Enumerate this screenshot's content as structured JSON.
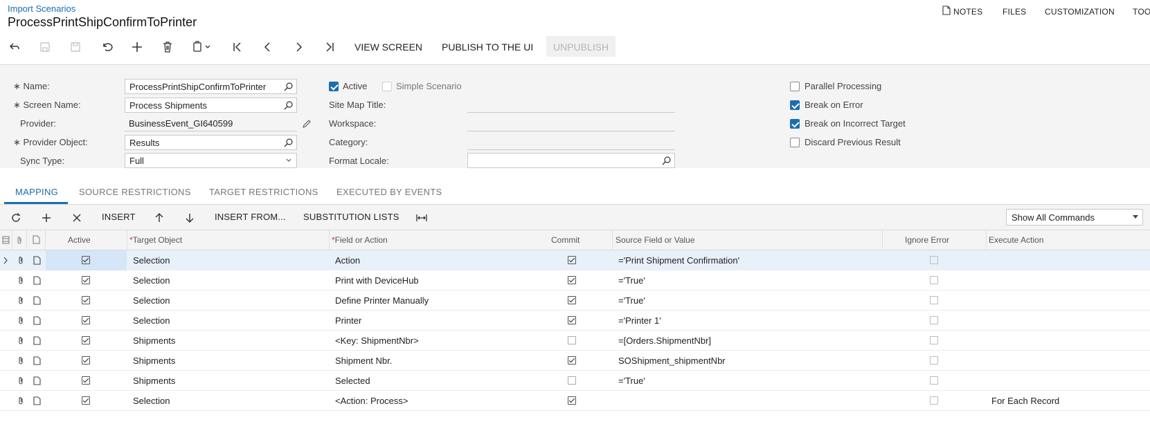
{
  "breadcrumb": "Import Scenarios",
  "page_title": "ProcessPrintShipConfirmToPrinter",
  "top_nav": [
    "NOTES",
    "FILES",
    "CUSTOMIZATION",
    "TOO"
  ],
  "toolbar": {
    "view_screen": "VIEW SCREEN",
    "publish": "PUBLISH TO THE UI",
    "unpublish": "UNPUBLISH"
  },
  "form": {
    "name_label": "Name:",
    "name_value": "ProcessPrintShipConfirmToPrinter",
    "screen_name_label": "Screen Name:",
    "screen_name_value": "Process Shipments",
    "provider_label": "Provider:",
    "provider_value": "BusinessEvent_GI640599",
    "provider_object_label": "Provider Object:",
    "provider_object_value": "Results",
    "sync_type_label": "Sync Type:",
    "sync_type_value": "Full",
    "active_label": "Active",
    "simple_label": "Simple Scenario",
    "site_map_label": "Site Map Title:",
    "workspace_label": "Workspace:",
    "category_label": "Category:",
    "format_locale_label": "Format Locale:",
    "parallel_label": "Parallel Processing",
    "break_error_label": "Break on Error",
    "break_target_label": "Break on Incorrect Target",
    "discard_label": "Discard Previous Result"
  },
  "tabs": [
    "MAPPING",
    "SOURCE RESTRICTIONS",
    "TARGET RESTRICTIONS",
    "EXECUTED BY EVENTS"
  ],
  "grid_toolbar": {
    "insert": "INSERT",
    "insert_from": "INSERT FROM...",
    "substitution": "SUBSTITUTION LISTS",
    "filter_value": "Show All Commands"
  },
  "columns": {
    "active": "Active",
    "target": "Target Object",
    "field": "Field or Action",
    "commit": "Commit",
    "source": "Source Field or Value",
    "ignore": "Ignore Error",
    "execute": "Execute Action"
  },
  "rows": [
    {
      "target": "Selection",
      "field": "Action",
      "commit": true,
      "source": "='Print Shipment Confirmation'",
      "execute": ""
    },
    {
      "target": "Selection",
      "field": "Print with DeviceHub",
      "commit": true,
      "source": "='True'",
      "execute": ""
    },
    {
      "target": "Selection",
      "field": "Define Printer Manually",
      "commit": true,
      "source": "='True'",
      "execute": ""
    },
    {
      "target": "Selection",
      "field": "Printer",
      "commit": true,
      "source": "='Printer 1'",
      "execute": ""
    },
    {
      "target": "Shipments",
      "field": "<Key: ShipmentNbr>",
      "commit": false,
      "source": "=[Orders.ShipmentNbr]",
      "execute": ""
    },
    {
      "target": "Shipments",
      "field": "Shipment Nbr.",
      "commit": true,
      "source": "SOShipment_shipmentNbr",
      "execute": ""
    },
    {
      "target": "Shipments",
      "field": "Selected",
      "commit": false,
      "source": "='True'",
      "execute": ""
    },
    {
      "target": "Selection",
      "field": "<Action: Process>",
      "commit": true,
      "source": "",
      "execute": "For Each Record"
    }
  ]
}
